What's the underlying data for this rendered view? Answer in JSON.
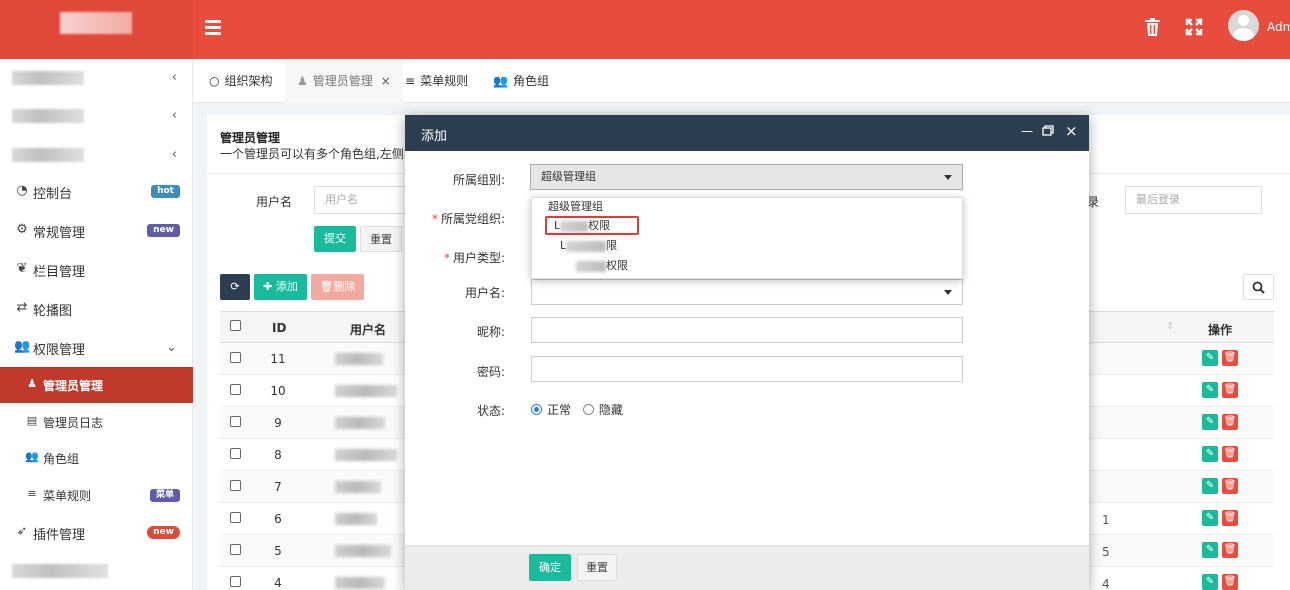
{
  "header": {
    "admin_name": "Adm"
  },
  "tabs": [
    {
      "icon": "circle-icon",
      "label": "组织架构"
    },
    {
      "icon": "user-icon",
      "label": "管理员管理"
    },
    {
      "icon": "list-icon",
      "label": "菜单规则"
    },
    {
      "icon": "users-icon",
      "label": "角色组"
    }
  ],
  "sidebar": {
    "items": [
      {
        "icon": "dashboard-icon",
        "label": "控制台",
        "badge": "hot",
        "badge_color": "#3c8dbc"
      },
      {
        "icon": "cogs-icon",
        "label": "常规管理",
        "badge": "new",
        "badge_color": "#605ca8"
      },
      {
        "icon": "leaf-icon",
        "label": "栏目管理"
      },
      {
        "icon": "exchange-icon",
        "label": "轮播图"
      },
      {
        "icon": "group-icon",
        "label": "权限管理"
      }
    ],
    "sub_items": [
      {
        "icon": "user-icon",
        "label": "管理员管理"
      },
      {
        "icon": "list-alt-icon",
        "label": "管理员日志"
      },
      {
        "icon": "group-icon",
        "label": "角色组"
      },
      {
        "icon": "bars-icon",
        "label": "菜单规则",
        "badge": "菜单",
        "badge_color": "#605ca8"
      }
    ],
    "plugin": {
      "icon": "rocket-icon",
      "label": "插件管理",
      "badge": "new",
      "badge_color": "#dd4b39"
    }
  },
  "panel": {
    "title": "管理员管理",
    "description": "一个管理员可以有多个角色组,左侧的菜",
    "search_label": "用户名",
    "search_placeholder": "用户名",
    "last_login_label": "录",
    "last_login_placeholder": "最后登录",
    "submit_label": "提交",
    "reset_label": "重置",
    "add_label": "添加",
    "delete_label": "删除"
  },
  "table": {
    "headers": {
      "id": "ID",
      "username": "用户名",
      "ops": "操作"
    },
    "rows": [
      {
        "id": "11",
        "frag": ""
      },
      {
        "id": "10",
        "frag": ""
      },
      {
        "id": "9",
        "frag": ""
      },
      {
        "id": "8",
        "frag": ""
      },
      {
        "id": "7",
        "frag": ""
      },
      {
        "id": "6",
        "frag": "1"
      },
      {
        "id": "5",
        "frag": "5"
      },
      {
        "id": "4",
        "frag": "4"
      }
    ]
  },
  "modal": {
    "title": "添加",
    "group_label": "所属组别:",
    "group_value": "超级管理组",
    "party_label": "所属党组织:",
    "usertype_label": "用户类型:",
    "username_label": "用户名:",
    "nickname_label": "昵称:",
    "password_label": "密码:",
    "status_label": "状态:",
    "status_normal": "正常",
    "status_hidden": "隐藏",
    "confirm_label": "确定",
    "reset_label": "重置",
    "dropdown": [
      {
        "prefix": "",
        "label": "超级管理组"
      },
      {
        "prefix": "L",
        "label": "权限"
      },
      {
        "prefix": "L",
        "label": "限"
      },
      {
        "prefix": "",
        "label": "权限"
      }
    ]
  }
}
